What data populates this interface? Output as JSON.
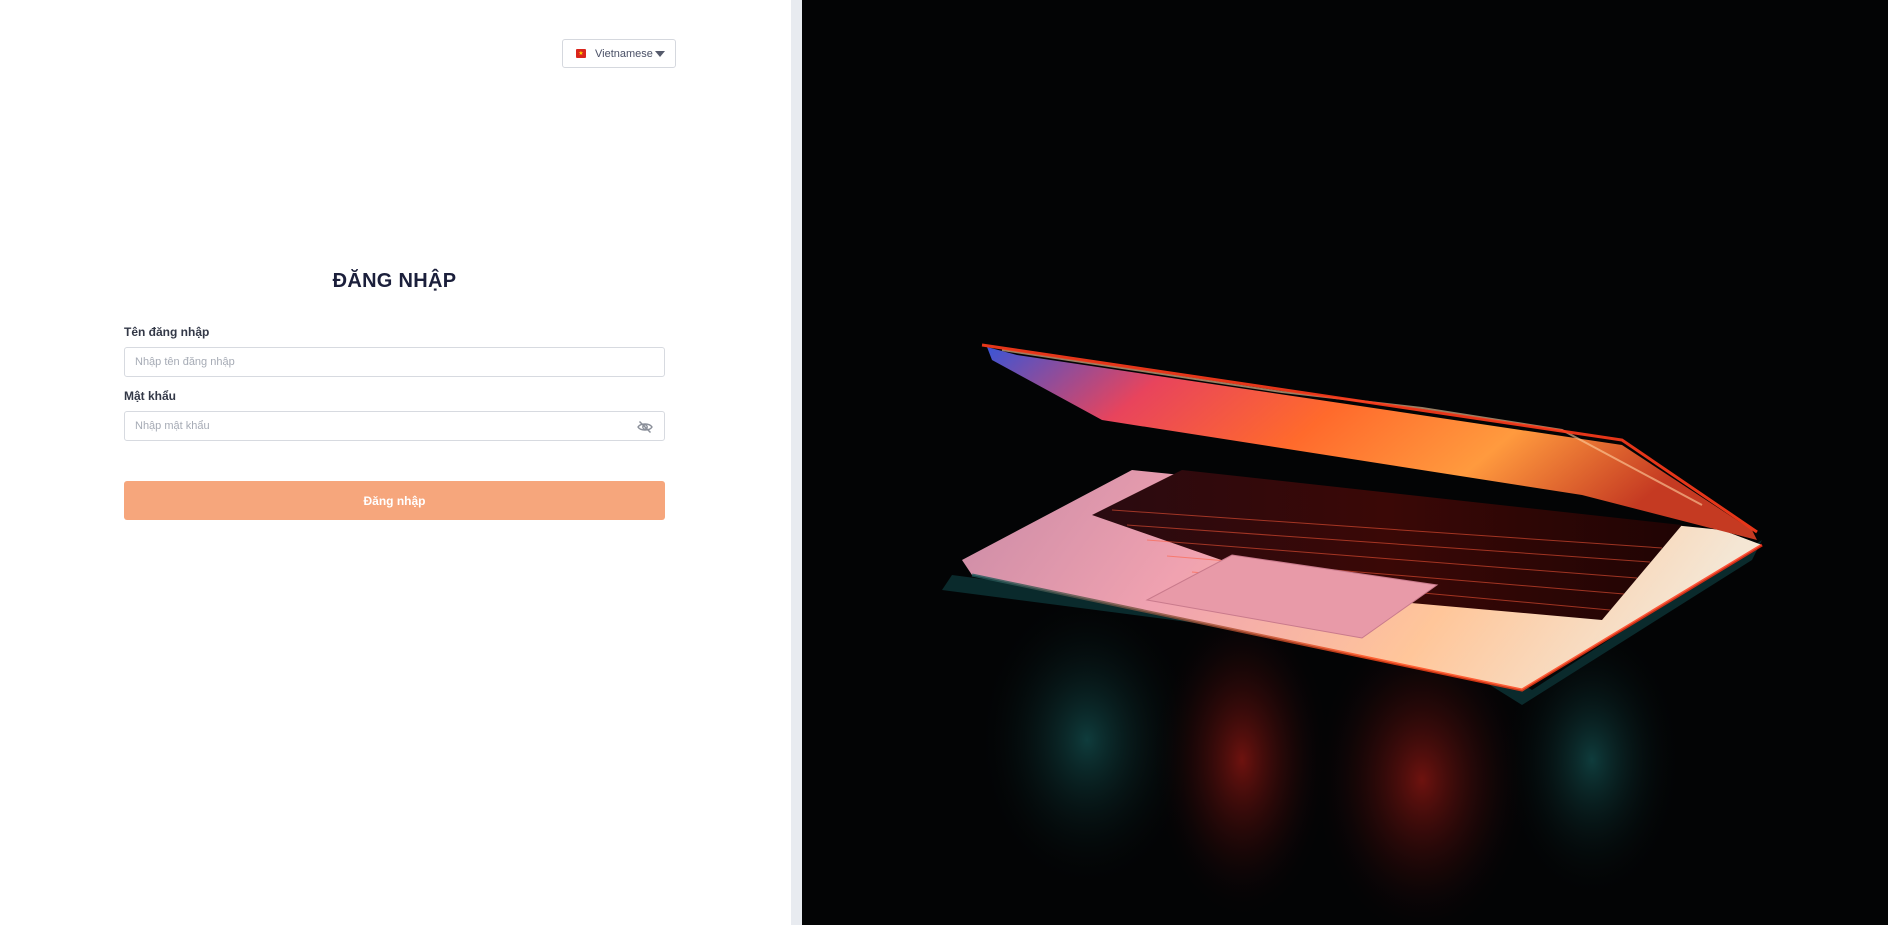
{
  "language_selector": {
    "label": "Vietnamese",
    "flag_icon": "vietnam-flag-icon",
    "flag_color": "#da251d"
  },
  "login": {
    "title": "ĐĂNG NHẬP",
    "username": {
      "label": "Tên đăng nhập",
      "placeholder": "Nhập tên đăng nhập",
      "value": ""
    },
    "password": {
      "label": "Mật khẩu",
      "placeholder": "Nhập mật khẩu",
      "value": "",
      "toggle_icon": "eye-slash-icon"
    },
    "submit_label": "Đăng nhập"
  },
  "colors": {
    "accent": "#f6a67c",
    "title": "#1b1f3b",
    "hero_background": "#030405"
  },
  "hero": {
    "image": "laptop-backlit-keyboard-photo"
  }
}
